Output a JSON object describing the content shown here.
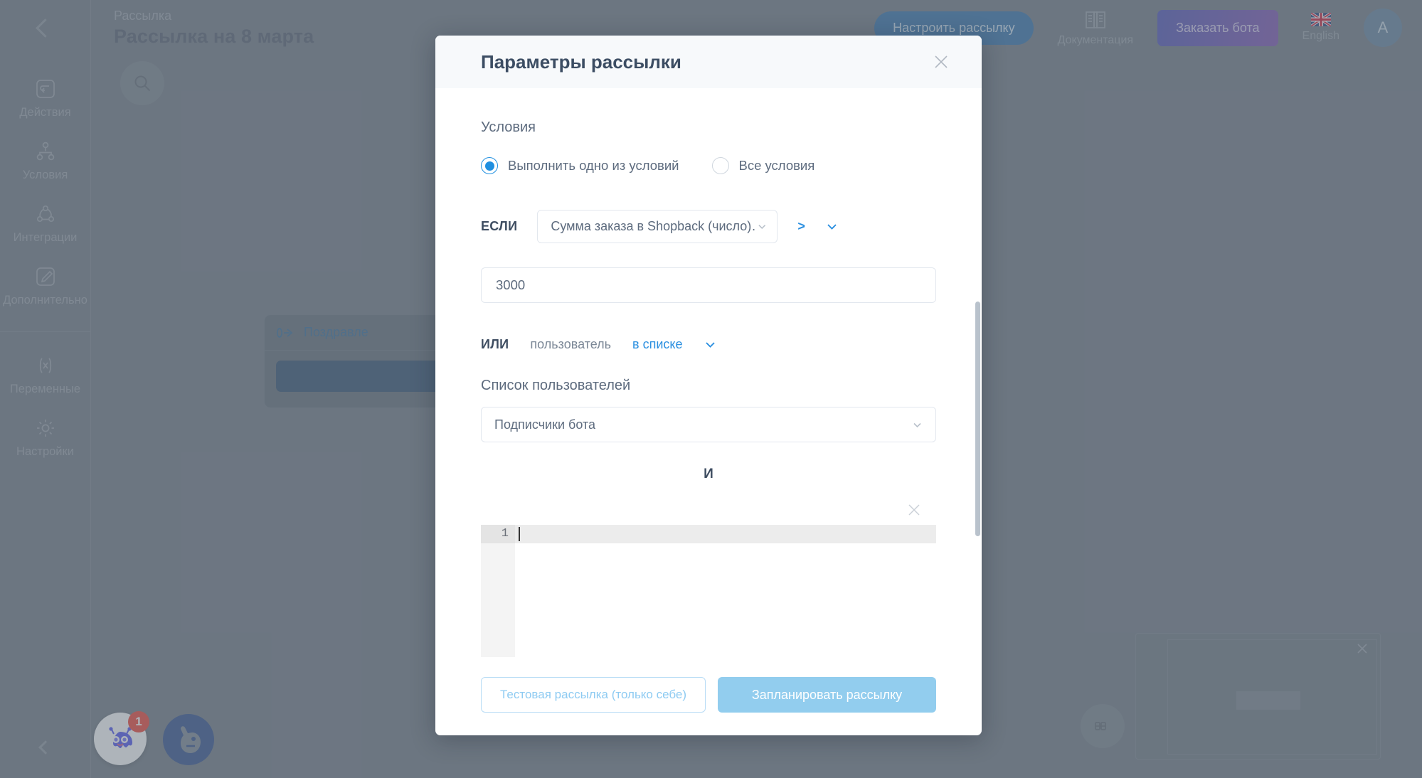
{
  "header": {
    "back_icon": "chevron-left-icon",
    "breadcrumb": "Рассылка",
    "title": "Рассылка на 8 марта",
    "setup_button": "Настроить рассылку",
    "documentation_label": "Документация",
    "documentation_icon": "book-icon",
    "order_bot_button": "Заказать бота",
    "language_label": "English",
    "language_icon": "uk-flag-icon",
    "avatar_initial": "A"
  },
  "sidebar": {
    "items": [
      {
        "label": "Действия",
        "icon": "action-arrow-icon"
      },
      {
        "label": "Условия",
        "icon": "branch-icon"
      },
      {
        "label": "Интеграции",
        "icon": "integration-icon"
      },
      {
        "label": "Дополнительно",
        "icon": "pencil-square-icon"
      },
      {
        "label": "Переменные",
        "icon": "variable-x-icon"
      },
      {
        "label": "Настройки",
        "icon": "gear-icon"
      }
    ],
    "collapse_icon": "chevron-left-icon"
  },
  "canvas": {
    "search_icon": "search-icon",
    "node_title": "Поздравле",
    "node_icon": "flow-start-icon",
    "minimap_close_icon": "close-icon",
    "zoom_icon": "zoom-controls-icon",
    "chat_badge_count": "1",
    "chat_icon": "chat-bot-icon",
    "bot_icon": "bot-avatar-icon"
  },
  "modal": {
    "title": "Параметры рассылки",
    "close_icon": "close-icon",
    "conditions_label": "Условия",
    "radio_options": [
      {
        "label": "Выполнить одно из условий",
        "selected": true
      },
      {
        "label": "Все условия",
        "selected": false
      }
    ],
    "if_keyword": "ЕСЛИ",
    "if_field_value": "Сумма заказа в Shopback (число)…",
    "if_field_caret_icon": "chevron-down-icon",
    "operator": ">",
    "operator_caret_icon": "chevron-down-icon",
    "value_input": "3000",
    "or_keyword": "ИЛИ",
    "or_subject": "пользователь",
    "or_condition": "в списке",
    "or_caret_icon": "chevron-down-icon",
    "user_list_label": "Список пользователей",
    "user_list_value": "Подписчики бота",
    "user_list_caret_icon": "chevron-down-icon",
    "and_separator": "И",
    "editor_close_icon": "close-icon",
    "code_line_number": "1",
    "test_button": "Тестовая рассылка (только себе)",
    "schedule_button": "Запланировать рассылку"
  },
  "colors": {
    "accent_blue": "#2a8fe0",
    "header_blue": "#2e6ea8",
    "order_purple": "#5b4fb3",
    "badge_red": "#f03d2f",
    "disabled_blue": "#92cdee"
  }
}
